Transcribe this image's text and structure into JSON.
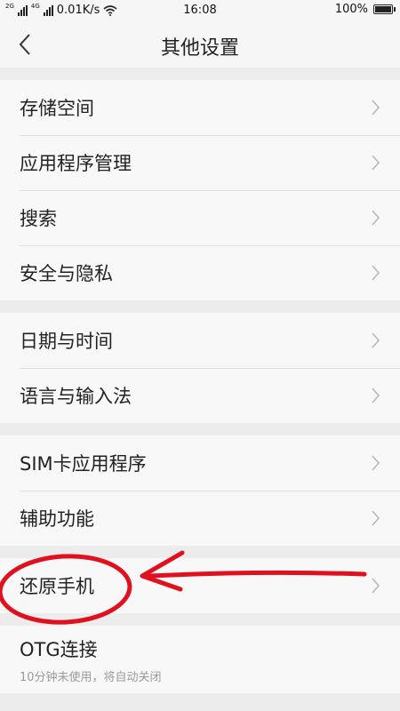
{
  "status_bar": {
    "net_2g": "2G",
    "net_4g": "4G",
    "speed": "0.01K/s",
    "time": "16:08",
    "battery": "100%",
    "battery_level": 1.0
  },
  "header": {
    "title": "其他设置",
    "back_icon": "back-arrow-icon"
  },
  "groups": [
    {
      "items": [
        {
          "label": "存储空间"
        },
        {
          "label": "应用程序管理"
        },
        {
          "label": "搜索"
        },
        {
          "label": "安全与隐私"
        }
      ]
    },
    {
      "items": [
        {
          "label": "日期与时间"
        },
        {
          "label": "语言与输入法"
        }
      ]
    },
    {
      "items": [
        {
          "label": "SIM卡应用程序"
        },
        {
          "label": "辅助功能"
        }
      ]
    },
    {
      "items": [
        {
          "label": "还原手机"
        }
      ]
    },
    {
      "items": [
        {
          "label": "OTG连接",
          "sub": "10分钟未使用，将自动关闭"
        }
      ]
    }
  ],
  "annotation": {
    "color": "#e0101e",
    "shapes": [
      "circle",
      "arrow"
    ]
  },
  "colors": {
    "background": "#ececec",
    "row": "#f8f8f8",
    "chevron": "#b8b8b8",
    "annotation": "#e0101e"
  }
}
